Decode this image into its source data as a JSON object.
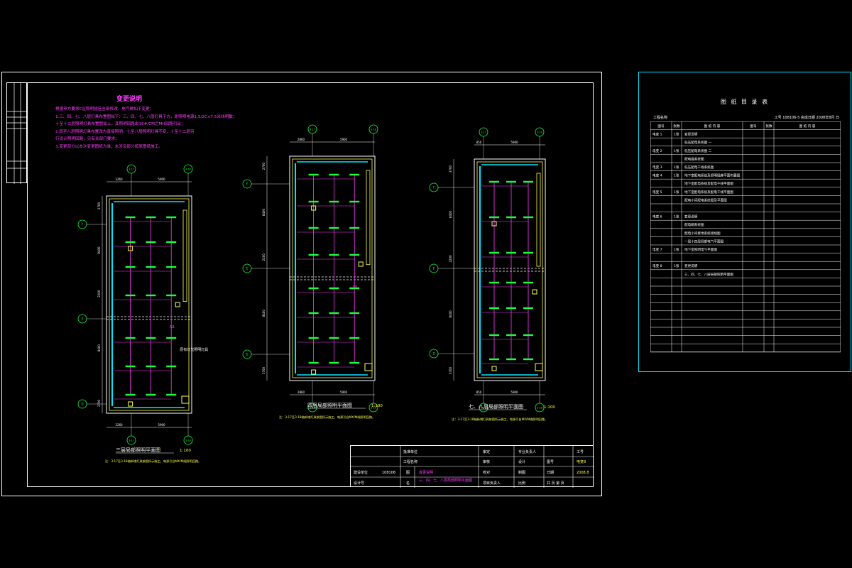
{
  "notes": {
    "title": "变更说明",
    "lines": [
      "根据甲方要求C区照明插座全部修改，电气做如下变更：",
      "1.三、四、七、八层灯具布置图如下：三、四、七、八层灯具下方，原照明电源1.5/2C×7.5米线明敷；",
      "  十至十二层照明灯具布置图如上，其照明回路由16#/CM之MH回路引出；",
      "2.四至八层照明灯具布置改为直接照明，七至八层照明灯具不变，十至十二层另",
      "  行设计照明回路，见有关部门要求；",
      "3.变更部分以本次变更图纸为准，未涉及部分按原图纸施工。"
    ]
  },
  "plans": [
    {
      "title": "三层局部照明平面图",
      "scale": "1:100",
      "note": "注：3-17至3-18轴新增灯具按图所示施工，电源引自MX/M线照明回路。",
      "dims_top": [
        "3260",
        "5900"
      ],
      "dims_bottom": [
        "3260",
        "5900"
      ],
      "dims_side": [
        "2700",
        "8400",
        "2200",
        "8400",
        "3700"
      ],
      "axes": [
        "3-17",
        "3-18",
        "F",
        "E",
        "D"
      ],
      "annot": "N1",
      "annot2": "原有灯光照明灯具"
    },
    {
      "title": "四层局部照明平面图",
      "scale": "1:100",
      "note": "注：3-17至3-18轴新增灯具按图所示施工，电源引自MX/M线照明回路。",
      "dims_top": [
        "2860",
        "5900"
      ],
      "dims_bottom": [
        "2860",
        "5900"
      ],
      "dims_side": [
        "2700",
        "8400",
        "2200",
        "8400",
        "3700"
      ],
      "axes": [
        "3-17",
        "3-18",
        "F",
        "E",
        "D"
      ],
      "annot": "N1"
    },
    {
      "title": "七、八层局部照明平面图",
      "scale": "1:100",
      "note": "注：3-17至3-18轴新增灯具按图所示施工，电源引自MX/M线照明回路。",
      "dims_top": [
        "850",
        "5900"
      ],
      "dims_bottom": [
        "850",
        "5900"
      ],
      "dims_side": [
        "3700",
        "8400",
        "2200",
        "8400",
        "3700"
      ],
      "axes": [
        "3-17",
        "3-18",
        "F",
        "E",
        "D"
      ]
    }
  ],
  "title_block": {
    "r1": [
      "批准单位",
      "审定",
      "专业负责人",
      "工号"
    ],
    "r2": [
      "工程名称",
      "审核",
      "设计",
      "图号",
      "电变8"
    ],
    "r3": [
      "建设单位",
      "108106",
      "图",
      "变更说明",
      "校对",
      "制图",
      "日期",
      "2008.8"
    ],
    "r4": [
      "设计号",
      "名",
      "三、四、七、八层局部照明平面图",
      "项目负责人",
      "比例",
      "共 页 第 页"
    ]
  },
  "index": {
    "title": "图 纸 目 录 表",
    "header_left": "工程名称",
    "header_right": "工号 108106-5   完成日期 2008年8月 日",
    "cols": [
      "图号",
      "张数",
      "图 纸 内 容",
      "图号",
      "张数",
      "图 纸 内 容"
    ],
    "rows": [
      [
        "电变 1",
        "1张",
        "变更说明"
      ],
      [
        "",
        "",
        "低压配电系统图 一"
      ],
      [
        "电变 2",
        "1张",
        "低压配电系统图 二"
      ],
      [
        "",
        "",
        "配电盘系统图"
      ],
      [
        "电变 3",
        "1张",
        "低压配电干线系统图"
      ],
      [
        "电变 4",
        "1张",
        "地下室配电系统及照明插座平面布置图"
      ],
      [
        "",
        "",
        "地下室配电系统及配电干线平面图"
      ],
      [
        "电变 5",
        "1张",
        "地下室配电系统及配电干线平面图"
      ],
      [
        "",
        "",
        "配电小间配电系统图及平面图"
      ],
      [
        "",
        "",
        ""
      ],
      [
        "电变 6",
        "1张",
        "变更说明"
      ],
      [
        "",
        "",
        "配电箱系统图"
      ],
      [
        "",
        "",
        "配电小间接地系统接线图"
      ],
      [
        "",
        "",
        "一层十四层局部电气平面图"
      ],
      [
        "电变 7",
        "1张",
        "地下室照明电气平面图"
      ],
      [
        "",
        "",
        ""
      ],
      [
        "电变 8",
        "1张",
        "变更说明"
      ],
      [
        "",
        "",
        "三、四、七、八层局部照明平面图"
      ],
      [
        "",
        "",
        ""
      ],
      [
        "",
        "",
        ""
      ],
      [
        "",
        "",
        ""
      ],
      [
        "",
        "",
        ""
      ],
      [
        "",
        "",
        ""
      ],
      [
        "",
        "",
        ""
      ],
      [
        "",
        "",
        ""
      ],
      [
        "",
        "",
        ""
      ],
      [
        "",
        "",
        ""
      ]
    ]
  },
  "colors": {
    "frame": "#ffffff",
    "cyan": "#00e5ff",
    "magenta": "#ff3cff",
    "green": "#19ff3c",
    "yellow": "#ffff50",
    "red": "#ff3030"
  }
}
